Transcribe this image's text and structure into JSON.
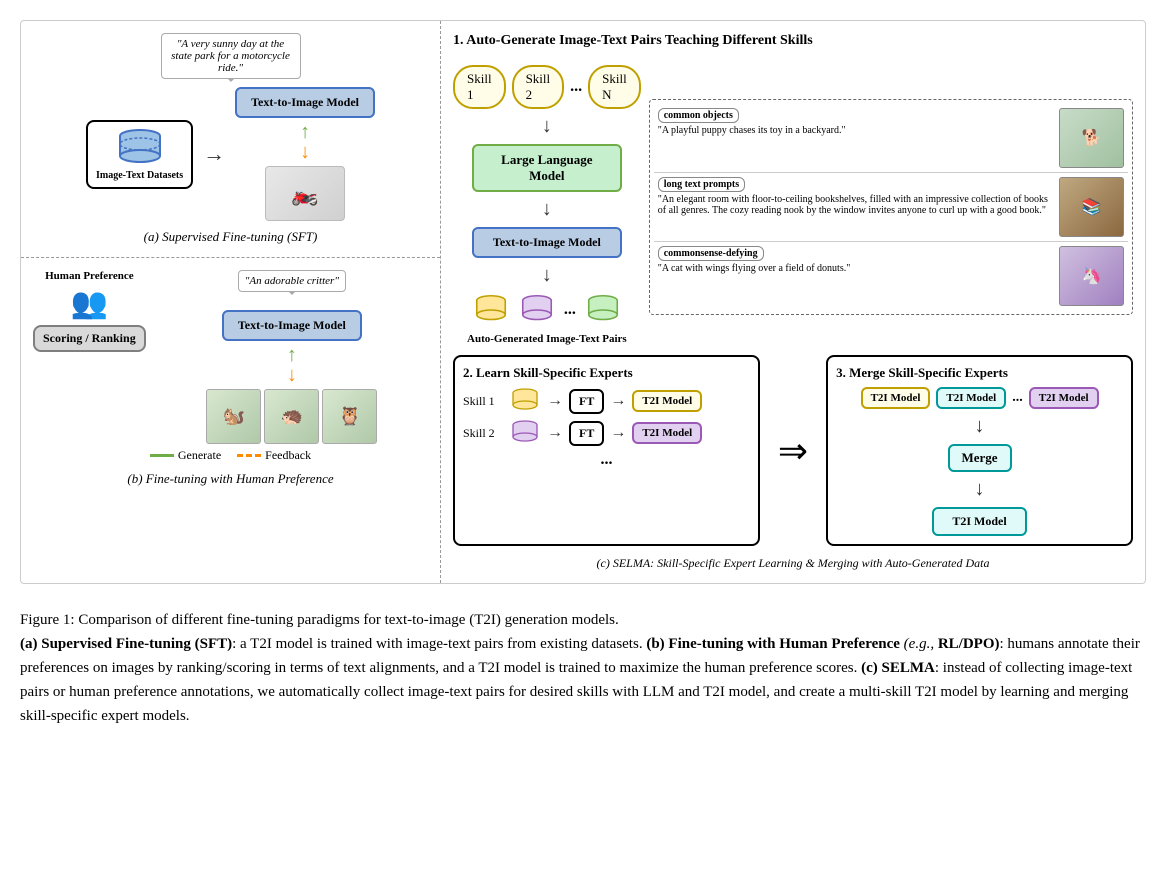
{
  "figure": {
    "panel_a_label": "(a) Supervised Fine-tuning (SFT)",
    "panel_b_label": "(b) Fine-tuning with Human Preference",
    "panel_c_label": "(c) SELMA: Skill-Specific Expert Learning & Merging with Auto-Generated Data",
    "step1_label": "1. Auto-Generate Image-Text Pairs Teaching Different Skills",
    "step2_label": "2. Learn Skill-Specific Experts",
    "step3_label": "3. Merge Skill-Specific Experts",
    "dataset_box_label": "Image-Text Datasets",
    "text_to_image_label": "Text-to-Image Model",
    "llm_label": "Large Language Model",
    "auto_gen_pairs_label": "Auto-Generated Image-Text Pairs",
    "skill1_label": "Skill 1",
    "skill2_label": "Skill 2",
    "skillN_label": "Skill N",
    "dots": "...",
    "quote_a": "\"A very sunny day at the state park for a motorcycle ride.\"",
    "quote_b": "\"An adorable critter\"",
    "human_pref_label": "Human Preference",
    "scoring_label": "Scoring / Ranking",
    "generate_label": "Generate",
    "feedback_label": "Feedback",
    "merge_label": "Merge",
    "ft_label": "FT",
    "t2i_label": "T2I Model",
    "skill1_row_label": "Skill 1",
    "skill2_row_label": "Skill 2",
    "common_objects_tag": "common objects",
    "common_objects_text": "\"A playful puppy chases its toy in a backyard.\"",
    "long_text_tag": "long text prompts",
    "long_text_text": "\"An elegant room with floor-to-ceiling bookshelves, filled with an impressive collection of books of all genres. The cozy reading nook by the window invites anyone to curl up with a good book.\"",
    "commonsense_tag": "commonsense-defying",
    "commonsense_text": "\"A cat with wings flying over a field of donuts.\""
  },
  "caption": {
    "intro": "Figure 1:   Comparison of different fine-tuning paradigms for text-to-image (T2I) generation models.",
    "part_a_label": "(a) Supervised Fine-tuning (SFT)",
    "part_a_text": ": a T2I model is trained with image-text pairs from existing datasets.",
    "part_b_label": "(b) Fine-tuning with Human Preference",
    "part_b_italic": "(e.g.,",
    "part_b_label2": "RL/DPO)",
    "part_b_text": ": humans annotate their preferences on images by ranking/scoring in terms of text alignments, and a T2I model is trained to maximize the human preference scores.",
    "part_c_label": "(c) SELMA",
    "part_c_text": ": instead of collecting image-text pairs or human preference annotations, we automatically collect image-text pairs for desired skills with LLM and T2I model, and create a multi-skill T2I model by learning and merging skill-specific expert models."
  }
}
